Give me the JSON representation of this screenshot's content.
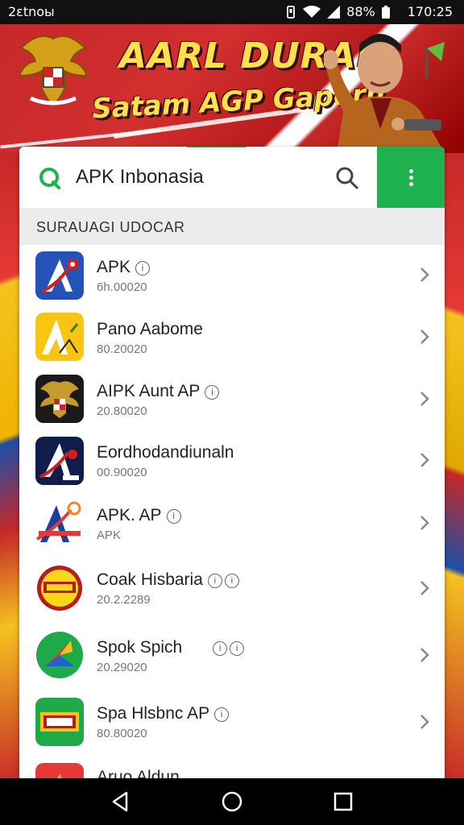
{
  "status_bar": {
    "left_text": "2ɛtnoы",
    "battery": "88%",
    "time": "170:25",
    "icons": [
      "vibrate-icon",
      "wifi-icon",
      "signal-icon",
      "battery-icon"
    ]
  },
  "banner": {
    "title": "AARL DURAN",
    "subtitle": "Satam AGP Gapern",
    "colors": {
      "red": "#c62828",
      "yellow": "#ffe14d"
    }
  },
  "search": {
    "value": "APK Inbonasia",
    "placeholder": "APK Inbonasia",
    "accent_color": "#1fb14f"
  },
  "section": {
    "label": "SURAUAGI UDOCAR"
  },
  "apps": [
    {
      "title": "APK",
      "sub": "6h.00020",
      "badge": "ⓘ",
      "icon": "apk-blue-a-icon"
    },
    {
      "title": "Pano Aabome",
      "sub": "80.20020",
      "badge": "",
      "icon": "yellow-a-icon"
    },
    {
      "title": "AIPK Aunt AP",
      "sub": "20.80020",
      "badge": "ⓘ",
      "icon": "garuda-emblem-icon"
    },
    {
      "title": "Eordhodandiunaln",
      "sub": "00.90020",
      "badge": "",
      "icon": "navy-a-icon"
    },
    {
      "title": "APK. AP",
      "sub": "APK",
      "badge": "ⓘ",
      "icon": "red-blue-a-icon"
    },
    {
      "title": "Coak Hisbaria",
      "sub": "20.2.2289",
      "badge": "ⓘⓘ",
      "icon": "round-yellow-logo-icon"
    },
    {
      "title": "Spok Spich",
      "sub": "20.29020",
      "badge": "ⓘⓘ",
      "icon": "colorful-pinwheel-icon"
    },
    {
      "title": "Spa Hlsbnc AP",
      "sub": "80.80020",
      "badge": "ⓘ",
      "icon": "green-game-logo-icon"
    },
    {
      "title": "Aruo Aldun",
      "sub": "",
      "badge": "",
      "icon": "red-app-icon"
    }
  ],
  "nav": {
    "back": "back-icon",
    "home": "home-icon",
    "recent": "recent-apps-icon"
  }
}
